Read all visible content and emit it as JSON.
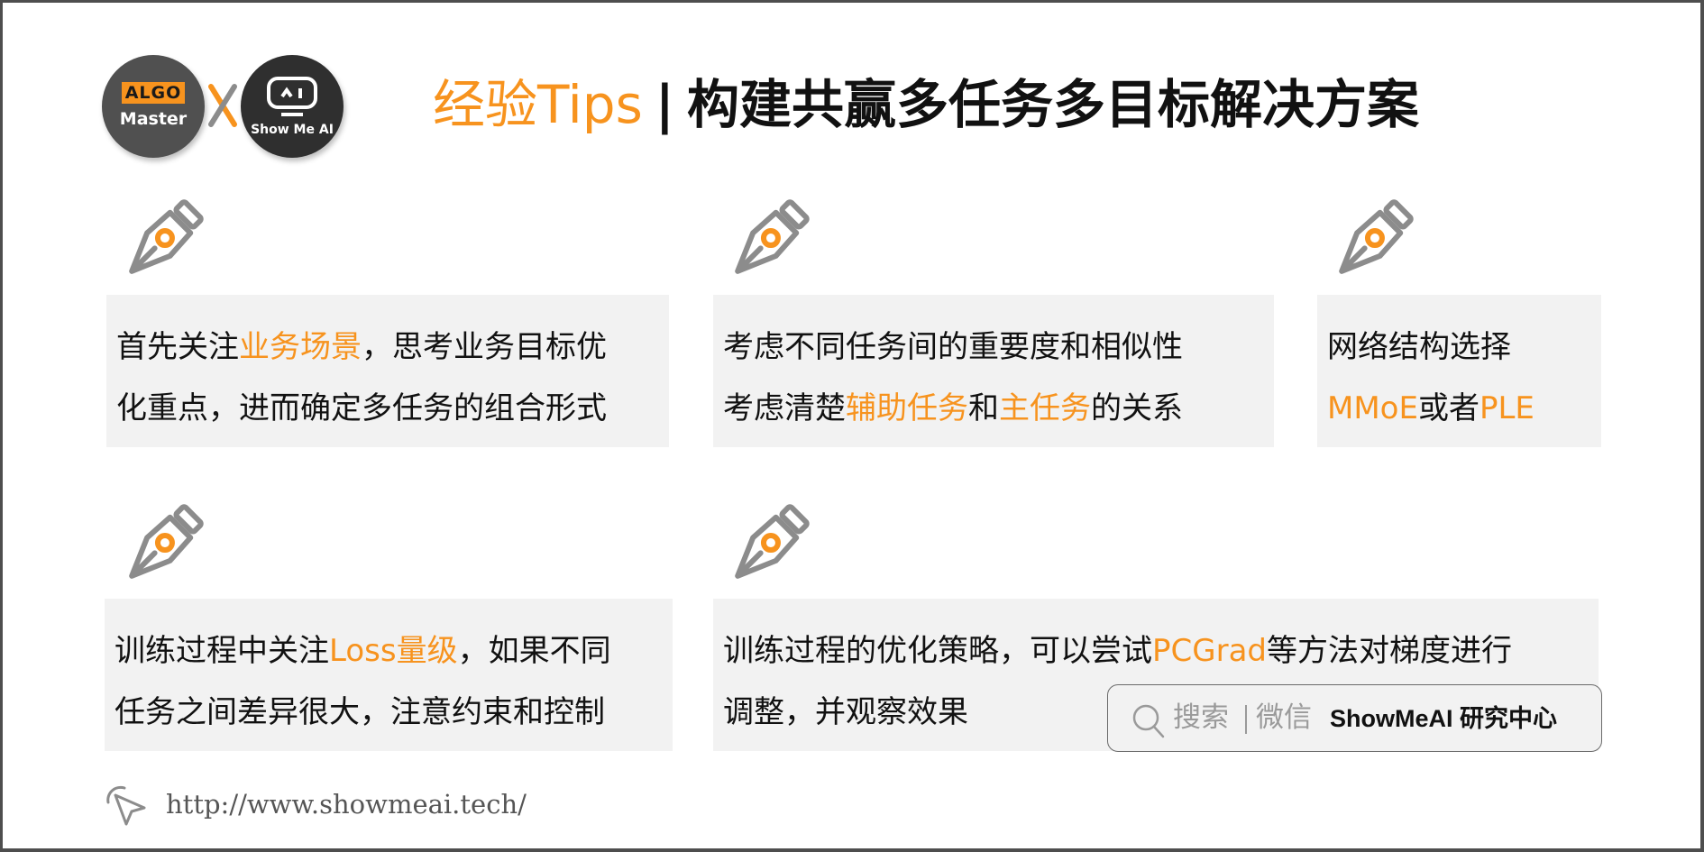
{
  "logos": {
    "left": {
      "badge": "ALGO",
      "name": "Master"
    },
    "connector": "x",
    "right": {
      "name": "Show Me AI"
    }
  },
  "title": {
    "accent": "经验Tips",
    "separator": "|",
    "main": "构建共赢多任务多目标解决方案"
  },
  "colors": {
    "accent": "#f7931e",
    "card_bg": "#f2f2f2",
    "text": "#111111",
    "icon_gray": "#8c8c8c",
    "frame": "#4e4e4e"
  },
  "cards": [
    {
      "icon": "fountain-pen-icon",
      "lines": [
        [
          {
            "t": "首先关注"
          },
          {
            "t": "业务场景",
            "hl": true
          },
          {
            "t": "，思考业务目标优"
          }
        ],
        [
          {
            "t": "化重点，进而确定多任务的组合形式"
          }
        ]
      ]
    },
    {
      "icon": "fountain-pen-icon",
      "lines": [
        [
          {
            "t": "考虑不同任务间的重要度和相似性"
          }
        ],
        [
          {
            "t": "考虑清楚"
          },
          {
            "t": "辅助任务",
            "hl": true
          },
          {
            "t": "和"
          },
          {
            "t": "主任务",
            "hl": true
          },
          {
            "t": "的关系"
          }
        ]
      ]
    },
    {
      "icon": "fountain-pen-icon",
      "lines": [
        [
          {
            "t": "网络结构选择"
          }
        ],
        [
          {
            "t": "MMoE",
            "hl": true
          },
          {
            "t": "或者"
          },
          {
            "t": "PLE",
            "hl": true
          }
        ]
      ]
    },
    {
      "icon": "fountain-pen-icon",
      "lines": [
        [
          {
            "t": "训练过程中关注"
          },
          {
            "t": "Loss量级",
            "hl": true
          },
          {
            "t": "，如果不同"
          }
        ],
        [
          {
            "t": "任务之间差异很大，注意约束和控制"
          }
        ]
      ]
    },
    {
      "icon": "fountain-pen-icon",
      "lines": [
        [
          {
            "t": "训练过程的优化策略，可以尝试"
          },
          {
            "t": "PCGrad",
            "hl": true
          },
          {
            "t": "等方法对梯度进行"
          }
        ],
        [
          {
            "t": "调整，并观察效果"
          }
        ]
      ]
    }
  ],
  "search_badge": {
    "icon": "search-icon",
    "hint1": "搜索",
    "hint2": "微信",
    "brand": "ShowMeAI 研究中心"
  },
  "footer": {
    "icon": "cursor-click-icon",
    "url": "http://www.showmeai.tech/"
  }
}
